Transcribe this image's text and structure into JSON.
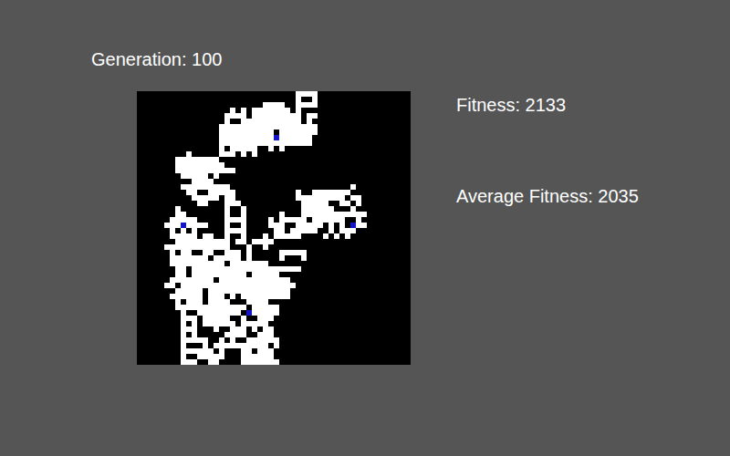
{
  "generation": {
    "label": "Generation: 100"
  },
  "stats": [
    {
      "label": "Fitness: 2133"
    },
    {
      "label": "Average Fitness: 2035"
    }
  ],
  "board": {
    "cell_states": {
      "#": "filled",
      "B": "agent",
      ".": "empty"
    },
    "rows": [
      ".............................####.................",
      ".............................#..#.................",
      ".......................####..####.................",
      ".................#.#.#######.#....................",
      "................####.#########.##.................",
      "................#..###########.#..................",
      "...............##################.................",
      "...............##########.#######................",
      "...............##########B######..................",
      "...............#################..................",
      "...............#.#####..#.#.......................",
      ".........#.....###.#.#............................",
      ".......########...................................",
      ".......#########..................................",
      ".......###########................................",
      "........#####.#...................................",
      "..........####....................................",
      "........#########......................#..........",
      ".........##..#####...........#..#######...........",
      "..........#####.##...........#########.##.........",
      "...........##...###...........#####..##.#.........",
      ".......#........#..#..........######...#..........",
      ".......##.......#..#......#...############........",
      "......#####.....####....#.#####.######..#.........",
      ".....###B####...#..#....###..#####.#.#.B##........",
      "......#.#.#.....####.....##.#####..#.###..........",
      "......#####.##..#..#...#.#####....#.#.#...........",
      ".......##########.##.####.........................",
      ".....############...#..#..........................",
      "......#.##..##..###.#.....#####...................",
      "......#######.#####.#.....#...#...................",
      "......##########.#######..........................",
      ".......##.####################....................",
      ".......##.##########.#####........................",
      "......########.#############......................",
      ".....##.#####################.....................",
      ".......#####.###############......................",
      "......######.###.#.#########......................",
      ".......#.###.####...####..........................",
      ".......#############.#####........................",
      "........#..########.B#####........................",
      "........###.#####..#..###.........................",
      "........#.#.######.#####..........................",
      "........###...#..###.#.##.........................",
      "........#.#.....####..###.........................",
      "........#####..#.#..######........................",
      "........#...#.##########.#........................",
      "........######.#...##.###.........................",
      "........#..#####...######.........................",
      "........###..##....#######........................"
    ]
  }
}
